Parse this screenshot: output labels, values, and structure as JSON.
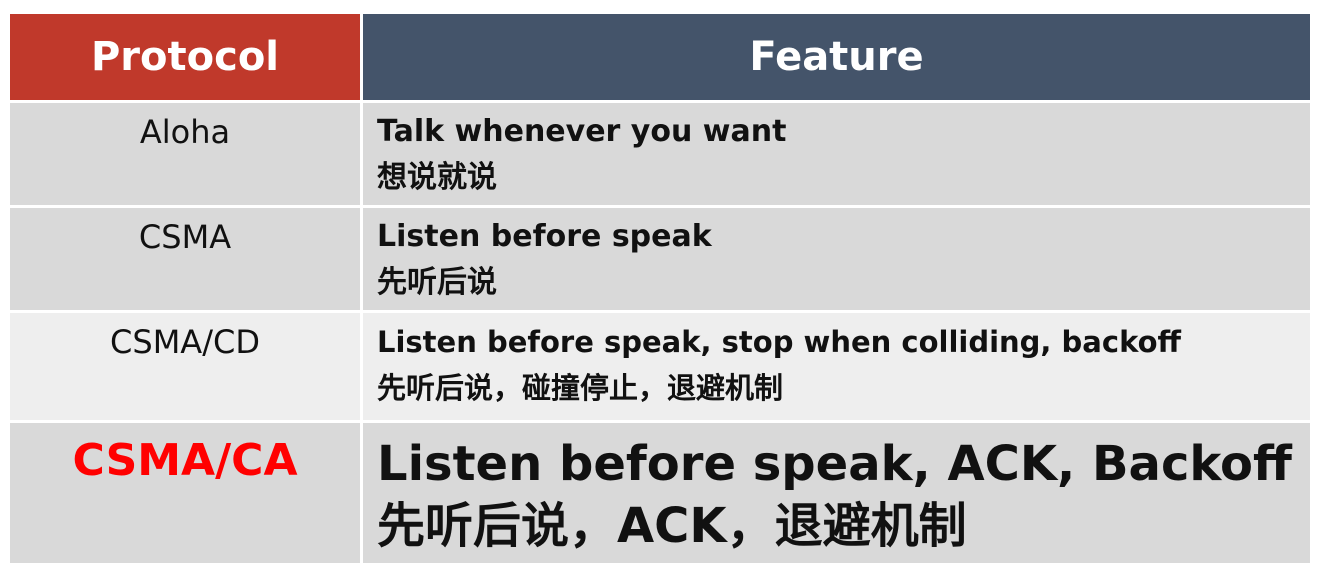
{
  "header": {
    "protocol": "Protocol",
    "feature": "Feature"
  },
  "rows": [
    {
      "protocol": "Aloha",
      "feature_en": "Talk whenever you want",
      "feature_zh": "想说就说"
    },
    {
      "protocol": "CSMA",
      "feature_en": "Listen before speak",
      "feature_zh": "先听后说"
    },
    {
      "protocol": "CSMA/CD",
      "feature_en": "Listen before speak, stop when colliding, backoff",
      "feature_zh": "先听后说，碰撞停止，退避机制"
    },
    {
      "protocol": "CSMA/CA",
      "feature_en": "Listen before speak, ACK, Backoff",
      "feature_zh": "先听后说，ACK，退避机制"
    }
  ],
  "colors": {
    "header_protocol_bg": "#c0392b",
    "header_feature_bg": "#44546a",
    "highlight_text": "#ff0000"
  }
}
